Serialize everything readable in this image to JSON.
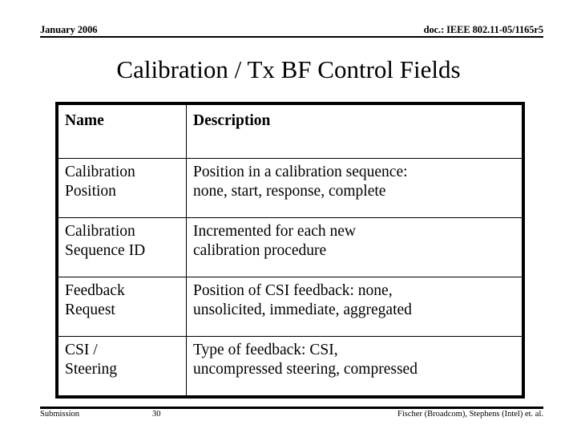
{
  "header": {
    "date": "January 2006",
    "doc": "doc.: IEEE 802.11-05/1165r5"
  },
  "title": "Calibration / Tx BF Control Fields",
  "table": {
    "columns": [
      "Name",
      "Description"
    ],
    "rows": [
      {
        "name_lines": [
          "Calibration",
          "Position"
        ],
        "description_lines": [
          "Position in a calibration sequence:",
          "none, start, response, complete"
        ]
      },
      {
        "name_lines": [
          "Calibration",
          "Sequence ID"
        ],
        "description_lines": [
          "Incremented for each new",
          "calibration procedure"
        ]
      },
      {
        "name_lines": [
          "Feedback",
          "Request"
        ],
        "description_lines": [
          "Position of CSI feedback: none,",
          "unsolicited, immediate, aggregated"
        ]
      },
      {
        "name_lines": [
          "CSI /",
          "Steering"
        ],
        "description_lines": [
          "Type of feedback: CSI,",
          "uncompressed steering, compressed"
        ]
      }
    ]
  },
  "footer": {
    "left": "Submission",
    "page": "30",
    "right": "Fischer (Broadcom), Stephens (Intel) et. al."
  },
  "colors": {
    "text": "#000000",
    "background": "#ffffff",
    "rule": "#000000"
  }
}
